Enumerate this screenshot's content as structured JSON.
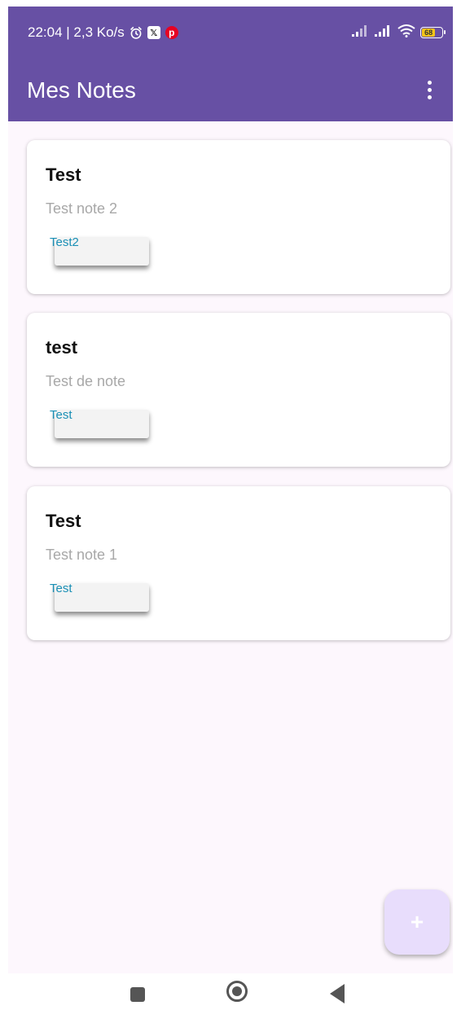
{
  "status_bar": {
    "time_speed": "22:04 | 2,3 Ko/s",
    "battery_level": "68",
    "icons": [
      "alarm-icon",
      "x-app-icon",
      "pinterest-icon",
      "signal-icon",
      "signal-icon",
      "wifi-icon",
      "battery-icon"
    ]
  },
  "app_bar": {
    "title": "Mes Notes",
    "menu_icon": "more-vert-icon"
  },
  "notes": [
    {
      "title": "Test",
      "content": "Test note 2",
      "tag": "Test2"
    },
    {
      "title": "test",
      "content": "Test de note",
      "tag": "Test"
    },
    {
      "title": "Test",
      "content": "Test note 1",
      "tag": "Test"
    }
  ],
  "fab": {
    "label": "+",
    "icon": "add-icon"
  },
  "colors": {
    "primary": "#6750a4",
    "background": "#fdf7fd",
    "fab_background": "#e8ddfc",
    "tag_text": "#1a8fb5"
  }
}
